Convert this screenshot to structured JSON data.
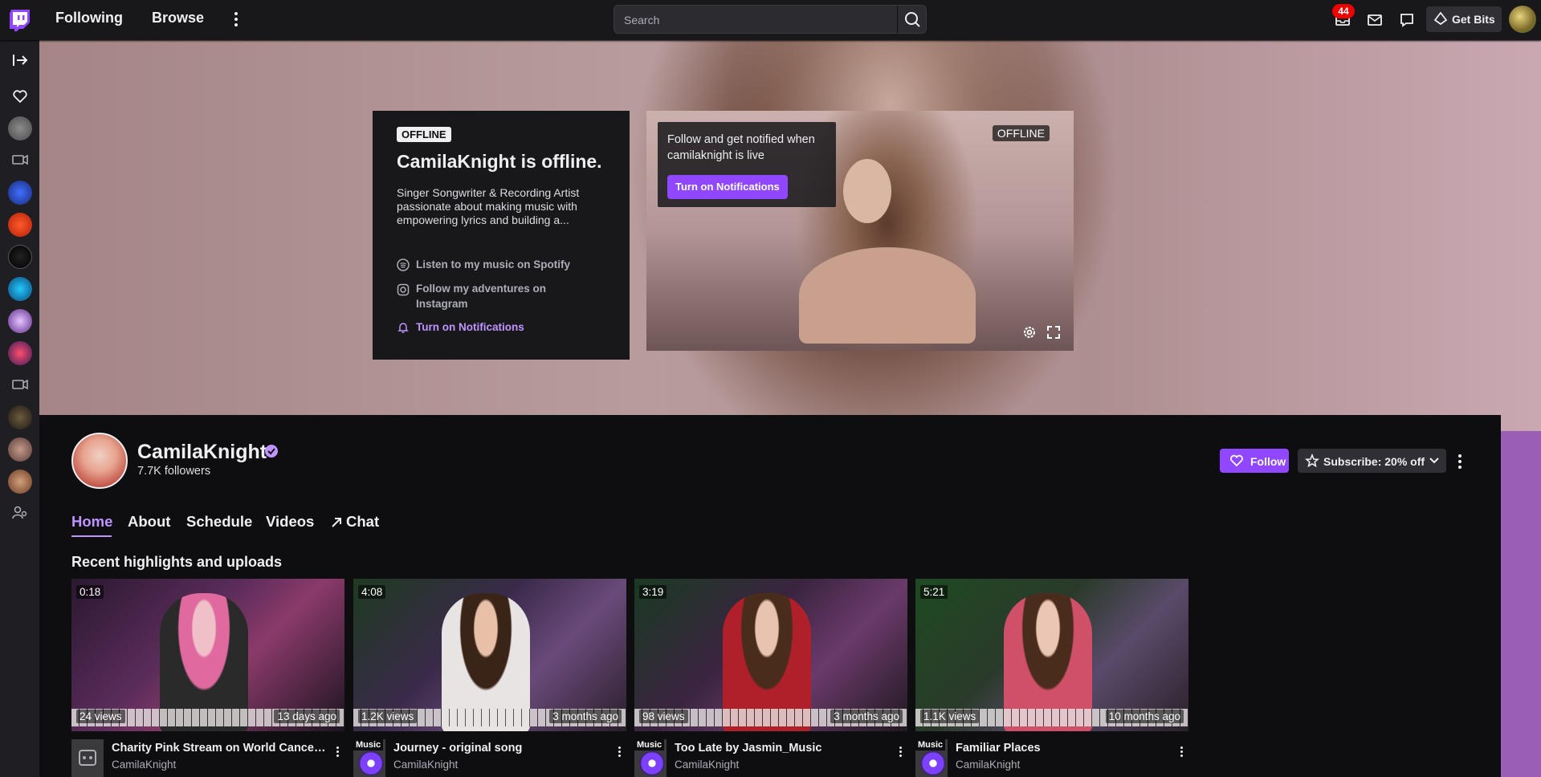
{
  "topbar": {
    "nav": [
      "Following",
      "Browse"
    ],
    "search_placeholder": "Search",
    "inbox_count": "44",
    "get_bits_label": "Get Bits"
  },
  "banner": {
    "offline_tag": "OFFLINE",
    "offline_title": "CamilaKnight is offline.",
    "bio": "Singer Songwriter & Recording Artist passionate about making music with empowering lyrics and building a...",
    "links": [
      {
        "label": "Listen to my music on Spotify",
        "icon": "spotify-icon"
      },
      {
        "label": "Follow my adventures on Instagram",
        "icon": "instagram-icon"
      }
    ],
    "notifications_link": "Turn on Notifications",
    "player": {
      "offline_label": "OFFLINE",
      "notify_text": "Follow and get notified when camilaknight is live",
      "notify_button": "Turn on Notifications"
    }
  },
  "channel": {
    "name": "CamilaKnight",
    "followers": "7.7K followers",
    "follow_label": "Follow",
    "subscribe_label": "Subscribe: 20% off",
    "tabs": [
      "Home",
      "About",
      "Schedule",
      "Videos",
      "Chat"
    ],
    "active_tab": "Home",
    "section_title": "Recent highlights and uploads",
    "videos": [
      {
        "duration": "0:18",
        "views": "24 views",
        "ago": "13 days ago",
        "title": "Charity Pink Stream on World Cancer ...",
        "channel": "CamilaKnight",
        "category_badge": ""
      },
      {
        "duration": "4:08",
        "views": "1.2K views",
        "ago": "3 months ago",
        "title": "Journey - original song",
        "channel": "CamilaKnight",
        "category_badge": "Music"
      },
      {
        "duration": "3:19",
        "views": "98 views",
        "ago": "3 months ago",
        "title": "Too Late by Jasmin_Music",
        "channel": "CamilaKnight",
        "category_badge": "Music"
      },
      {
        "duration": "5:21",
        "views": "1.1K views",
        "ago": "10 months ago",
        "title": "Familiar Places",
        "channel": "CamilaKnight",
        "category_badge": "Music"
      }
    ]
  },
  "colors": {
    "accent": "#9147ff",
    "accent_text": "#bf94ff",
    "background": "#0e0e10",
    "topbar": "#18181b",
    "alert": "#eb0400"
  }
}
